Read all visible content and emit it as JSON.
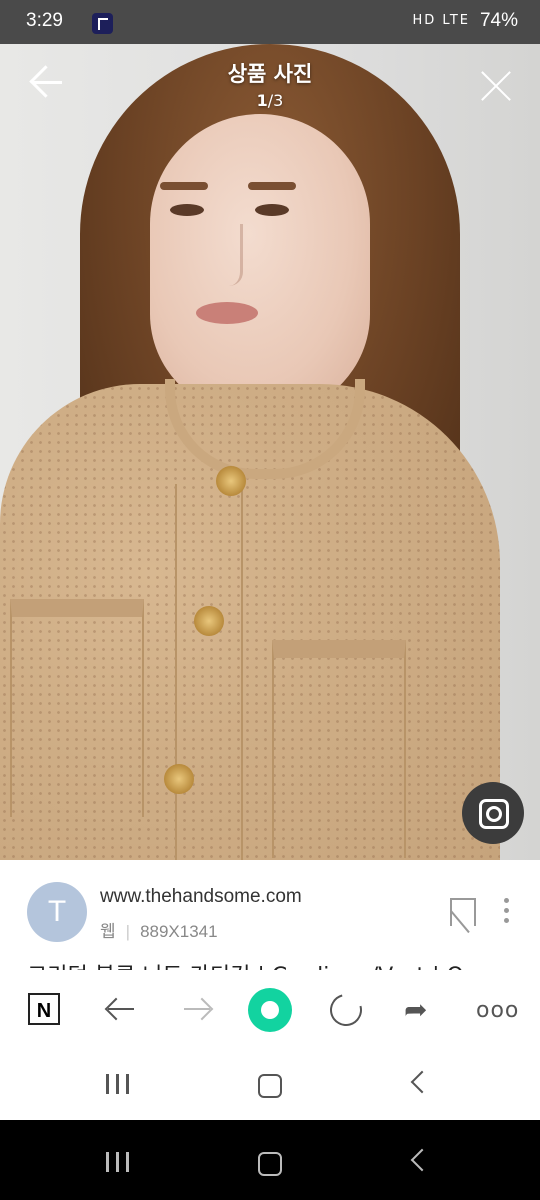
{
  "status_bar": {
    "time": "3:29",
    "network": "HD LTE",
    "battery": "74%"
  },
  "viewer": {
    "title": "상품 사진",
    "current": "1",
    "separator": "/",
    "total": "3"
  },
  "result": {
    "avatar_letter": "T",
    "domain": "www.thehandsome.com",
    "type": "웹",
    "dimensions": "889X1341",
    "title": "크리덤 블루 니트 가디건 | Cardigan/Vest | O"
  },
  "colors": {
    "home_accent": "#12d3a0",
    "avatar_bg": "#b4c5dc"
  },
  "toolbar": {
    "naver_label": "N",
    "more_label": "ooo"
  }
}
